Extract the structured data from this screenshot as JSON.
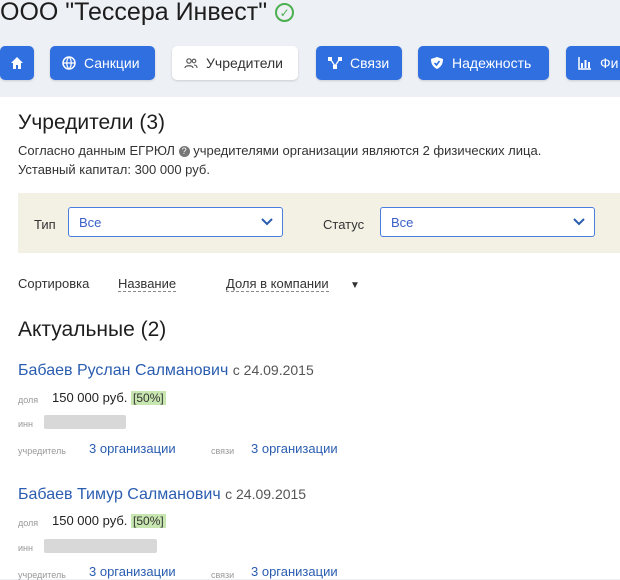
{
  "company": {
    "name": "ООО \"Тессера Инвест\""
  },
  "tabs": [
    {
      "label": ""
    },
    {
      "label": "Санкции"
    },
    {
      "label": "Учредители"
    },
    {
      "label": "Связи"
    },
    {
      "label": "Надежность"
    },
    {
      "label": "Фи"
    }
  ],
  "section": {
    "title": "Учредители (3)",
    "info_prefix": "Согласно данным ЕГРЮЛ",
    "info_suffix": "учредителями организации являются 2 физических лица.",
    "capital": "Уставный капитал: 300 000 руб."
  },
  "filters": {
    "type_label": "Тип",
    "type_value": "Все",
    "status_label": "Статус",
    "status_value": "Все"
  },
  "sort": {
    "label": "Сортировка",
    "by_name": "Название",
    "by_share": "Доля в компании"
  },
  "group": {
    "title": "Актуальные (2)"
  },
  "persons": [
    {
      "name": "Бабаев Руслан Салманович",
      "since": "с 24.09.2015",
      "share_label": "доля",
      "share": "150 000 руб.",
      "percent": "[50%]",
      "inn_label": "инн",
      "founder_label": "учредитель",
      "founder_link": "3 организации",
      "links_label": "связи",
      "links_link": "3 организации"
    },
    {
      "name": "Бабаев Тимур Салманович",
      "since": "с 24.09.2015",
      "share_label": "доля",
      "share": "150 000 руб.",
      "percent": "[50%]",
      "inn_label": "инн",
      "founder_label": "учредитель",
      "founder_link": "3 организации",
      "links_label": "связи",
      "links_link": "3 организации"
    }
  ]
}
